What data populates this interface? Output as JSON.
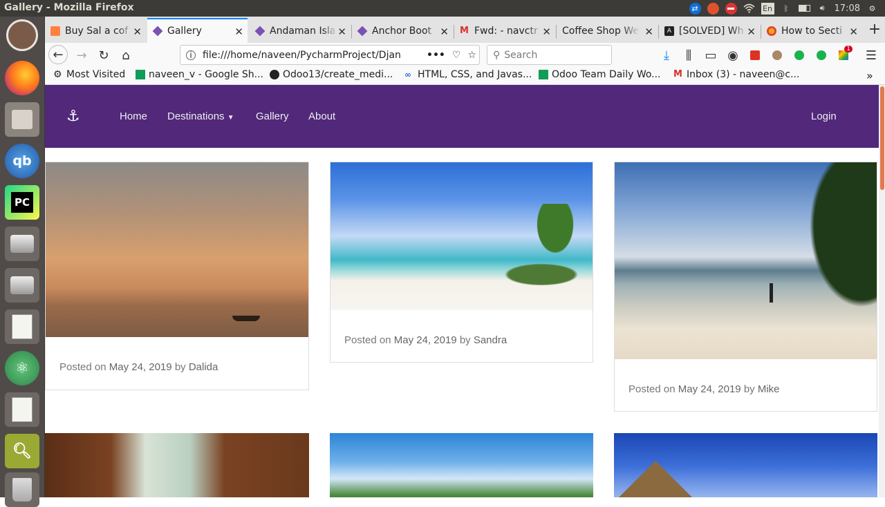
{
  "window": {
    "title": "Gallery - Mozilla Firefox"
  },
  "tray": {
    "keyboard": "En",
    "time": "17:08"
  },
  "tabs": [
    {
      "label": "Buy Sal a cof",
      "active": false
    },
    {
      "label": "Gallery",
      "active": true
    },
    {
      "label": "Andaman Isla",
      "active": false
    },
    {
      "label": "Anchor Boot",
      "active": false
    },
    {
      "label": "Fwd: - navctr",
      "active": false
    },
    {
      "label": "Coffee Shop We",
      "active": false
    },
    {
      "label": "[SOLVED] Wh",
      "active": false
    },
    {
      "label": "How to Secti",
      "active": false
    }
  ],
  "url": {
    "value": "file:///home/naveen/PycharmProject/Djan",
    "search_placeholder": "Search"
  },
  "bookmarks": [
    {
      "label": "Most Visited"
    },
    {
      "label": "naveen_v - Google Sh..."
    },
    {
      "label": "Odoo13/create_medi..."
    },
    {
      "label": "HTML, CSS, and Javas..."
    },
    {
      "label": "Odoo Team Daily Wo..."
    },
    {
      "label": "Inbox (3) - naveen@c..."
    }
  ],
  "addon_badge": "1",
  "site": {
    "nav": {
      "home": "Home",
      "destinations": "Destinations",
      "gallery": "Gallery",
      "about": "About",
      "login": "Login"
    },
    "posts": [
      {
        "posted": "Posted on",
        "date": "May 24, 2019",
        "by": "by",
        "author": "Dalida"
      },
      {
        "posted": "Posted on",
        "date": "May 24, 2019",
        "by": "by",
        "author": "Sandra"
      },
      {
        "posted": "Posted on",
        "date": "May 24, 2019",
        "by": "by",
        "author": "Mike"
      }
    ]
  },
  "colors": {
    "site_nav": "#51287a",
    "firefox_accent": "#0a84ff"
  }
}
